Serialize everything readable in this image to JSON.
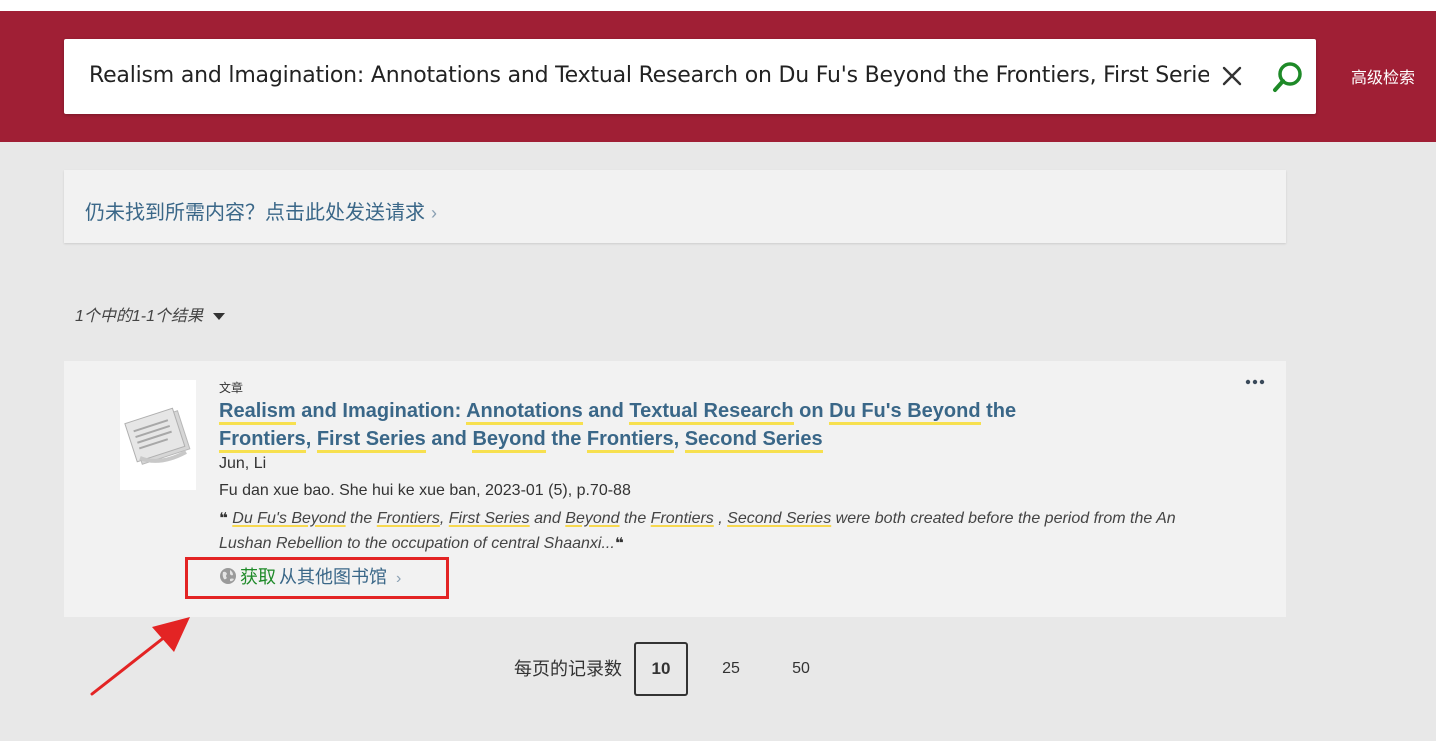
{
  "search": {
    "query": "Realism and lmagination: Annotations and Textual Research on Du Fu's Beyond the Frontiers, First Series and B",
    "advanced_label": "高级检索"
  },
  "request": {
    "label": "仍未找到所需内容？点击此处发送请求",
    "chevron": "›"
  },
  "results": {
    "count_label": "1个中的1-1个结果"
  },
  "record": {
    "type": "文章",
    "title_parts": [
      {
        "t": "Realism",
        "hl": true
      },
      {
        "t": " and Imagination: ",
        "hl": false
      },
      {
        "t": "Annotations",
        "hl": true
      },
      {
        "t": " and ",
        "hl": false
      },
      {
        "t": "Textual Research",
        "hl": true
      },
      {
        "t": " on ",
        "hl": false
      },
      {
        "t": "Du Fu's Beyond",
        "hl": true
      },
      {
        "t": " the ",
        "hl": false
      },
      {
        "t": "Frontiers",
        "hl": true
      },
      {
        "t": ", ",
        "hl": false
      },
      {
        "t": "First Series",
        "hl": true
      },
      {
        "t": " and ",
        "hl": false
      },
      {
        "t": "Beyond",
        "hl": true
      },
      {
        "t": " the ",
        "hl": false
      },
      {
        "t": "Frontiers",
        "hl": true
      },
      {
        "t": ", ",
        "hl": false
      },
      {
        "t": "Second Series",
        "hl": true
      }
    ],
    "author": "Jun, Li",
    "source": "Fu dan xue bao. She hui ke xue ban, 2023-01 (5), p.70-88",
    "snippet_parts": [
      {
        "t": "Du Fu's Beyond",
        "u": true
      },
      {
        "t": " the ",
        "u": false
      },
      {
        "t": "Frontiers",
        "u": true
      },
      {
        "t": ", ",
        "u": false
      },
      {
        "t": "First Series",
        "u": true
      },
      {
        "t": " and ",
        "u": false
      },
      {
        "t": "Beyond",
        "u": true
      },
      {
        "t": " the ",
        "u": false
      },
      {
        "t": "Frontiers",
        "u": true
      },
      {
        "t": " , ",
        "u": false
      },
      {
        "t": "Second Series",
        "u": true
      },
      {
        "t": " were both created before the period from the An Lushan Rebellion to the occupation of central Shaanxi...",
        "u": false
      }
    ],
    "quote_open": "❝",
    "quote_close": "❝",
    "availability": {
      "get_label": "获取",
      "rest_label": "从其他图书馆",
      "chevron": "›"
    }
  },
  "pagination": {
    "per_page_label": "每页的记录数",
    "options": [
      "10",
      "25",
      "50"
    ],
    "selected": "10"
  },
  "colors": {
    "header": "#a01f35",
    "link": "#3a6788",
    "available_green": "#1e8a28",
    "highlight": "#f7e04f",
    "annotation_red": "#e32424"
  }
}
